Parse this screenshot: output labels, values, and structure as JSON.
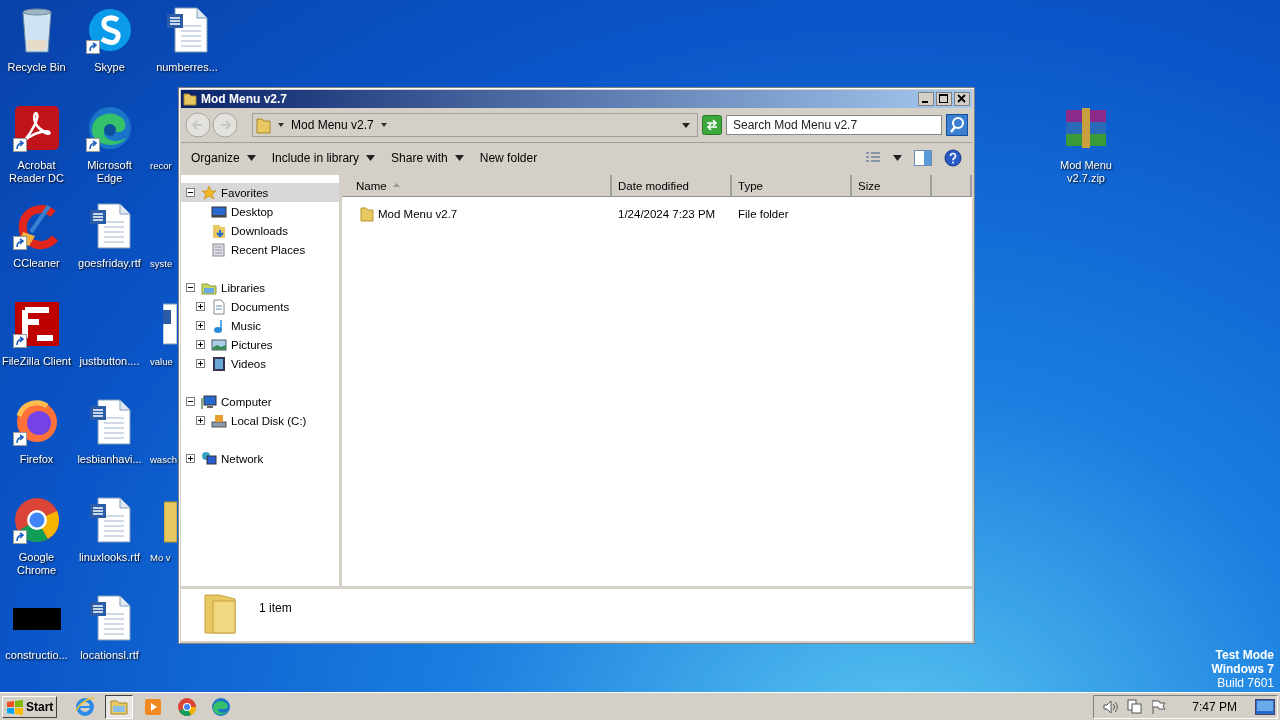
{
  "desktop": {
    "columns": [
      [
        {
          "label": "Recycle Bin",
          "kind": "recycle",
          "shortcut": false
        },
        {
          "label": "Acrobat Reader DC",
          "kind": "pdf",
          "shortcut": true
        },
        {
          "label": "CCleaner",
          "kind": "ccleaner",
          "shortcut": true
        },
        {
          "label": "FileZilla Client",
          "kind": "filezilla",
          "shortcut": true
        },
        {
          "label": "Firefox",
          "kind": "firefox",
          "shortcut": true
        },
        {
          "label": "Google Chrome",
          "kind": "chrome",
          "shortcut": true
        },
        {
          "label": "constructio...",
          "kind": "black",
          "shortcut": false
        }
      ],
      [
        {
          "label": "Skype",
          "kind": "skype",
          "shortcut": true
        },
        {
          "label": "Microsoft Edge",
          "kind": "edge",
          "shortcut": true
        },
        {
          "label": "goesfriday.rtf",
          "kind": "word",
          "shortcut": false
        },
        {
          "label": "justbutton....",
          "kind": "blank",
          "shortcut": false
        },
        {
          "label": "lesbianhavi...",
          "kind": "word",
          "shortcut": false
        },
        {
          "label": "linuxlooks.rtf",
          "kind": "word",
          "shortcut": false
        },
        {
          "label": "locationsl.rtf",
          "kind": "word",
          "shortcut": false
        }
      ],
      [
        {
          "label": "numberres...",
          "kind": "word",
          "shortcut": false
        },
        {
          "label": "recor",
          "kind": "blank",
          "shortcut": false
        },
        {
          "label": "syste",
          "kind": "blank",
          "shortcut": false
        },
        {
          "label": "value",
          "kind": "word-sliver",
          "shortcut": false
        },
        {
          "label": "wasch",
          "kind": "blank",
          "shortcut": false
        },
        {
          "label": "Mo v",
          "kind": "folder-sliver",
          "shortcut": false
        }
      ]
    ],
    "right_icons": [
      {
        "label": "Mod Menu v2.7.zip",
        "kind": "archive",
        "shortcut": false
      }
    ],
    "system_text": [
      "Test Mode",
      "Windows 7",
      "Build 7601"
    ]
  },
  "window": {
    "title": "Mod Menu v2.7",
    "address": {
      "crumbs": [
        "Mod Menu v2.7"
      ]
    },
    "search": {
      "placeholder": "Search Mod Menu v2.7"
    },
    "commands": [
      {
        "label": "Organize",
        "menu": true
      },
      {
        "label": "Include in library",
        "menu": true
      },
      {
        "label": "Share with",
        "menu": true
      },
      {
        "label": "New folder",
        "menu": false
      }
    ],
    "nav_tree": [
      {
        "label": "Favorites",
        "kind": "star",
        "expanded": true,
        "selected": true,
        "children": [
          {
            "label": "Desktop",
            "kind": "desktop",
            "selected": false
          },
          {
            "label": "Downloads",
            "kind": "downloads",
            "selected": false
          },
          {
            "label": "Recent Places",
            "kind": "recent",
            "selected": false
          }
        ]
      },
      {
        "label": "Libraries",
        "kind": "libraries",
        "expanded": true,
        "selected": false,
        "children": [
          {
            "label": "Documents",
            "kind": "documents",
            "expanded": false,
            "selected": false
          },
          {
            "label": "Music",
            "kind": "music",
            "expanded": false,
            "selected": false
          },
          {
            "label": "Pictures",
            "kind": "pictures",
            "expanded": false,
            "selected": false
          },
          {
            "label": "Videos",
            "kind": "videos",
            "expanded": false,
            "selected": false
          }
        ]
      },
      {
        "label": "Computer",
        "kind": "computer",
        "expanded": true,
        "selected": false,
        "children": [
          {
            "label": "Local Disk (C:)",
            "kind": "disk",
            "expanded": false,
            "selected": false
          }
        ]
      },
      {
        "label": "Network",
        "kind": "network",
        "expanded": false,
        "selected": false
      }
    ],
    "columns": [
      {
        "label": "Name",
        "sorted": true
      },
      {
        "label": "Date modified",
        "sorted": false
      },
      {
        "label": "Type",
        "sorted": false
      },
      {
        "label": "Size",
        "sorted": false
      }
    ],
    "rows": [
      {
        "name": "Mod Menu v2.7",
        "date_modified": "1/24/2024 7:23 PM",
        "type": "File folder"
      }
    ],
    "details": {
      "summary": "1 item"
    }
  },
  "taskbar": {
    "start": "Start",
    "apps": [
      {
        "kind": "ie",
        "selected": false
      },
      {
        "kind": "explorer",
        "selected": true
      },
      {
        "kind": "media",
        "selected": false
      },
      {
        "kind": "chrome",
        "selected": false
      },
      {
        "kind": "edge",
        "selected": false
      }
    ],
    "clock": "7:47 PM"
  }
}
